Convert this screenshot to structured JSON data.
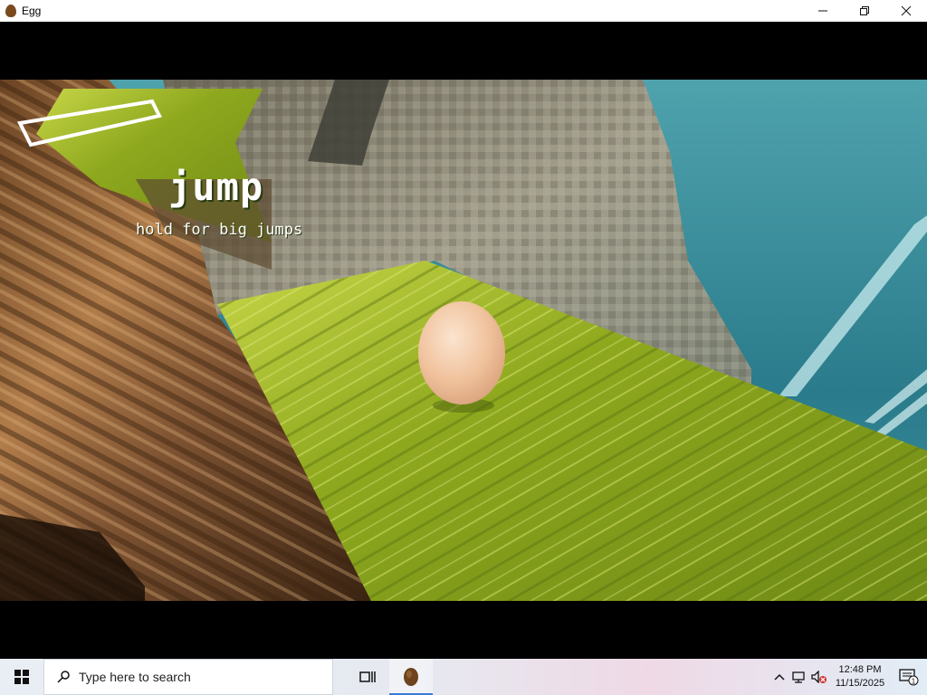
{
  "window": {
    "title": "Egg",
    "controls": [
      "minimize-icon",
      "maximize-icon",
      "close-icon"
    ]
  },
  "hud": {
    "action": "jump",
    "hint": "hold for big jumps"
  },
  "colors": {
    "grass": "#9fb526",
    "cliff": "#8c8877",
    "wood": "#9a6a3c",
    "water": "#2f7f8f",
    "egg": "#f2caa4"
  },
  "taskbar": {
    "search_placeholder": "Type here to search",
    "time": "12:48 PM",
    "date": "11/15/2025",
    "notification_count": "1",
    "icons": [
      "windows-start-icon",
      "search-icon",
      "task-view-icon",
      "egg-app-icon",
      "chevron-up-icon",
      "network-icon",
      "volume-muted-icon",
      "notification-icon"
    ]
  }
}
